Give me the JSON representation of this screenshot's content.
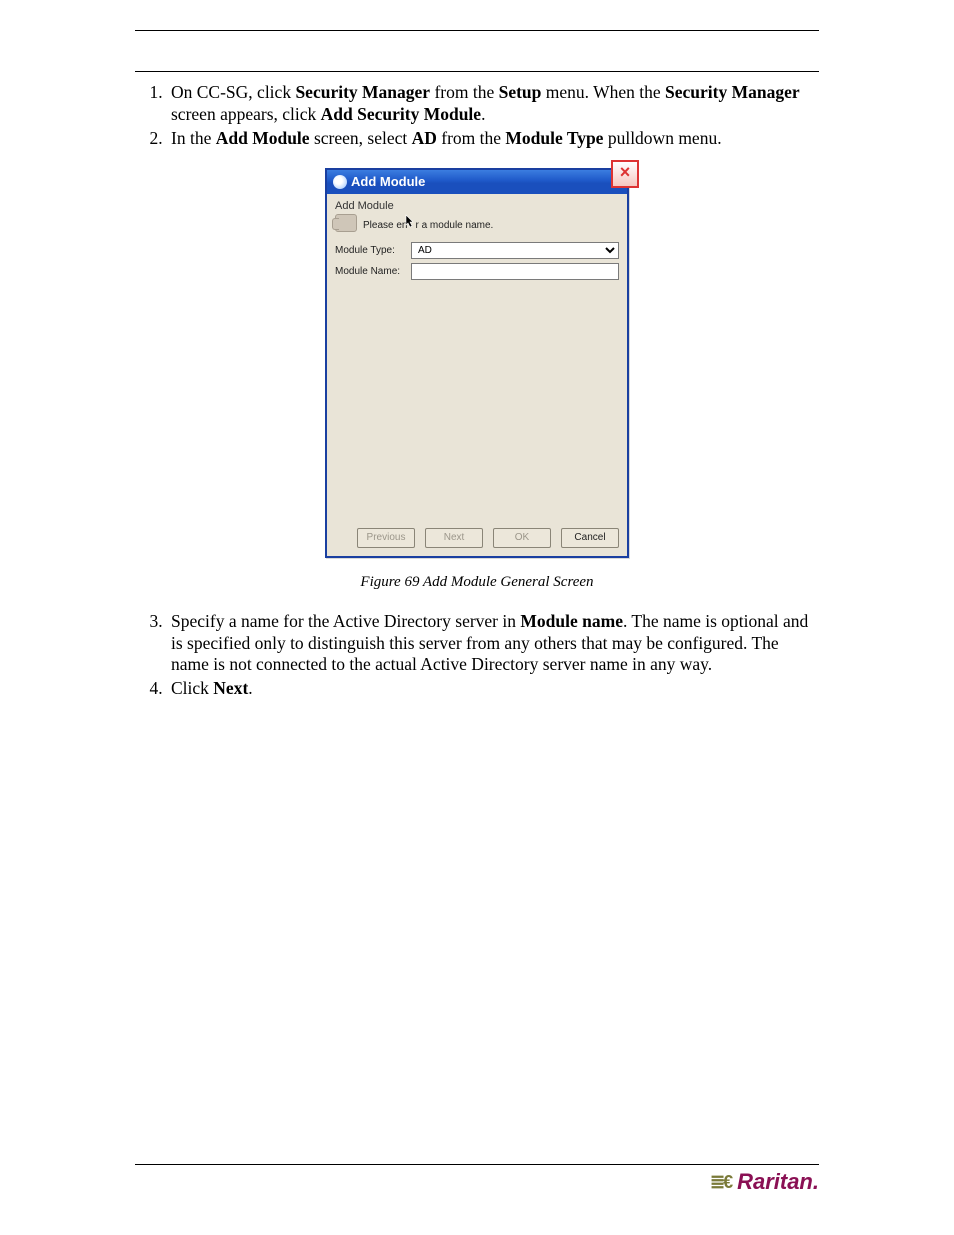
{
  "page": {
    "step1": {
      "t1": "On CC-SG, click ",
      "b1": "Security Manager",
      "t2": " from the ",
      "b2": "Setup",
      "t3": " menu.  When the ",
      "b3": "Security Manager",
      "t4": " screen appears, click ",
      "b4": "Add Security Module",
      "t5": "."
    },
    "step2": {
      "t1": "In the ",
      "b1": "Add Module",
      "t2": " screen, select ",
      "b2": "AD",
      "t3": " from the ",
      "b3": "Module Type",
      "t4": " pulldown menu."
    },
    "step3": {
      "t1": "Specify a name for the Active Directory server in ",
      "b1": "Module name",
      "t2": ". The name is optional and is specified only to distinguish this server from any others that may be configured. The name is not connected to the actual Active Directory server name in any way."
    },
    "step4": {
      "t1": "Click ",
      "b1": "Next",
      "t2": "."
    },
    "figure_caption": "Figure 69 Add Module General Screen"
  },
  "dialog": {
    "title": "Add Module",
    "subtitle": "Add Module",
    "hint": "Please enter a module name.",
    "labels": {
      "type": "Module Type:",
      "name": "Module Name:"
    },
    "type_value": "AD",
    "name_value": "",
    "buttons": {
      "previous": "Previous",
      "next": "Next",
      "ok": "OK",
      "cancel": "Cancel"
    }
  },
  "brand": "Raritan."
}
